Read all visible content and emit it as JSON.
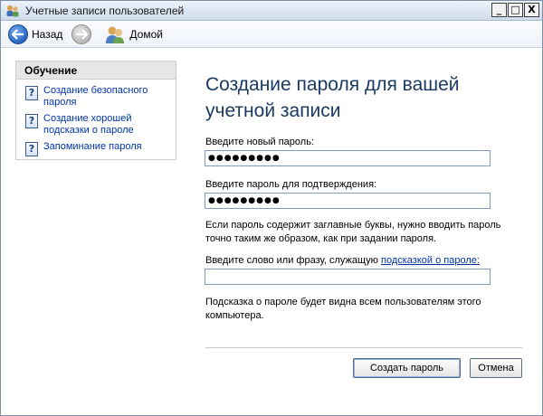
{
  "window": {
    "title": "Учетные записи пользователей",
    "controls": {
      "minimize": "_",
      "maximize": "□",
      "close": "X"
    }
  },
  "nav": {
    "back_label": "Назад",
    "home_label": "Домой",
    "icons": {
      "back": "back-arrow-icon",
      "forward": "forward-arrow-icon",
      "home": "user-accounts-icon"
    }
  },
  "sidebar": {
    "header": "Обучение",
    "items": [
      {
        "label": "Создание безопасного пароля",
        "icon": "help-icon"
      },
      {
        "label": "Создание хорошей подсказки о пароле",
        "icon": "help-icon"
      },
      {
        "label": "Запоминание пароля",
        "icon": "help-icon"
      }
    ]
  },
  "main": {
    "heading": "Создание пароля для вашей учетной записи",
    "new_password_label": "Введите новый пароль:",
    "new_password_value": "●●●●●●●●●",
    "confirm_label": "Введите пароль для подтверждения:",
    "confirm_value": "●●●●●●●●●",
    "case_note": "Если пароль содержит заглавные буквы, нужно вводить пароль точно таким же образом, как при задании пароля.",
    "hint_label_prefix": "Введите слово или фразу, служащую ",
    "hint_label_link": "подсказкой о пароле:",
    "hint_value": "",
    "hint_note": "Подсказка о пароле будет видна всем пользователям этого компьютера.",
    "create_button": "Создать пароль",
    "cancel_button": "Отмена"
  },
  "colors": {
    "heading": "#1b3a63",
    "link": "#0033aa",
    "titlebar": "#dbe5f2"
  }
}
